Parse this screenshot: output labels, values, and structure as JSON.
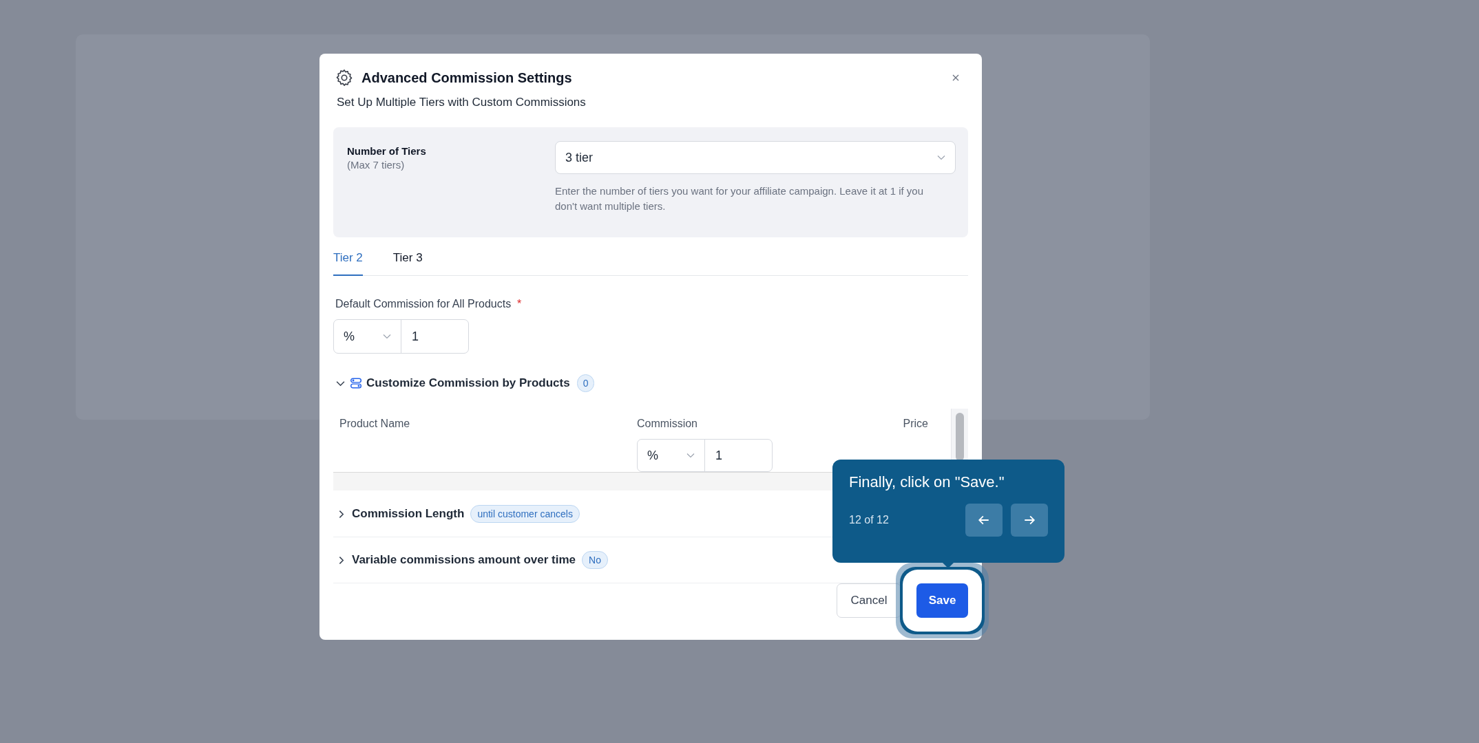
{
  "modal": {
    "title": "Advanced Commission Settings",
    "subtitle": "Set Up Multiple Tiers with Custom Commissions"
  },
  "tiers": {
    "label": "Number of Tiers",
    "hint": "(Max 7 tiers)",
    "value": "3 tier",
    "help": "Enter the number of tiers you want for your affiliate campaign. Leave it at 1 if you don't want multiple tiers."
  },
  "tabs": [
    {
      "label": "Tier 2",
      "selected": true
    },
    {
      "label": "Tier 3",
      "selected": false
    }
  ],
  "default_commission": {
    "label": "Default Commission for All Products",
    "required_mark": "*",
    "type": "%",
    "value": "1"
  },
  "customize": {
    "label": "Customize Commission by Products",
    "count": "0",
    "expanded": true,
    "columns": [
      "Product Name",
      "Commission",
      "Price"
    ],
    "rows": [
      {
        "type": "%",
        "value": "1"
      }
    ]
  },
  "sections": [
    {
      "label": "Commission Length",
      "badge": "until customer cancels",
      "expanded": false
    },
    {
      "label": "Variable commissions amount over time",
      "badge": "No",
      "expanded": false
    }
  ],
  "buttons": {
    "cancel": "Cancel",
    "save": "Save"
  },
  "tour": {
    "text": "Finally, click on \"Save.\"",
    "progress": "12 of 12"
  }
}
